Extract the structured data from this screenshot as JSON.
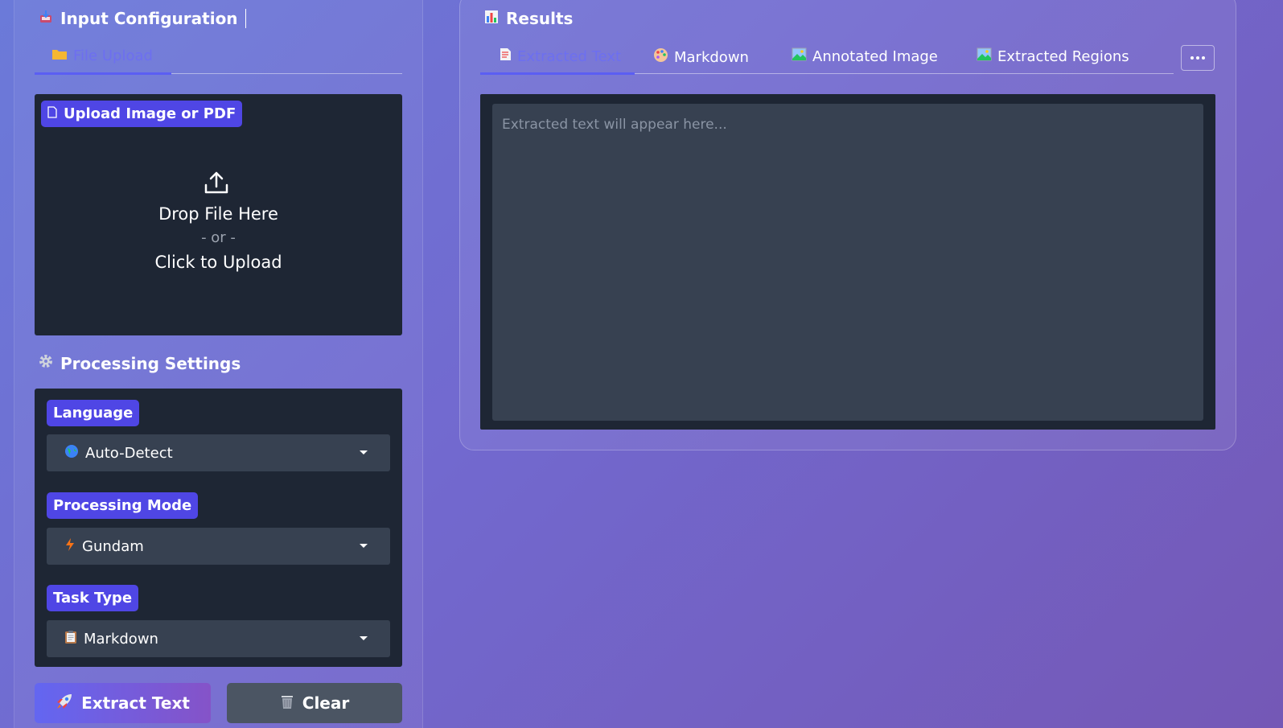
{
  "left": {
    "title": "Input Configuration",
    "title_icon": "inbox-tray-icon",
    "tab": {
      "label": "File Upload",
      "icon": "folder-icon"
    },
    "upload": {
      "label": "Upload Image or PDF",
      "drop_text": "Drop File Here",
      "or_text": "- or -",
      "click_text": "Click to Upload"
    },
    "settings": {
      "title": "Processing Settings",
      "title_icon": "gear-icon",
      "language": {
        "label": "Language",
        "value": "Auto-Detect",
        "icon": "globe-icon"
      },
      "mode": {
        "label": "Processing Mode",
        "value": "Gundam",
        "icon": "lightning-icon"
      },
      "task": {
        "label": "Task Type",
        "value": "Markdown",
        "icon": "clipboard-icon"
      }
    },
    "buttons": {
      "extract": "Extract Text",
      "clear": "Clear"
    }
  },
  "right": {
    "title": "Results",
    "title_icon": "bar-chart-icon",
    "tabs": [
      {
        "label": "Extracted Text",
        "icon": "document-icon",
        "active": true
      },
      {
        "label": "Markdown",
        "icon": "palette-icon",
        "active": false
      },
      {
        "label": "Annotated Image",
        "icon": "picture-icon",
        "active": false
      },
      {
        "label": "Extracted Regions",
        "icon": "picture-icon",
        "active": false
      }
    ],
    "output_placeholder": "Extracted text will appear here..."
  },
  "colors": {
    "accent": "#4f46e5",
    "active_tab": "#6d6ff0",
    "panel_dark": "#1e2634",
    "field": "#374151",
    "clear_button": "#4b5563"
  }
}
